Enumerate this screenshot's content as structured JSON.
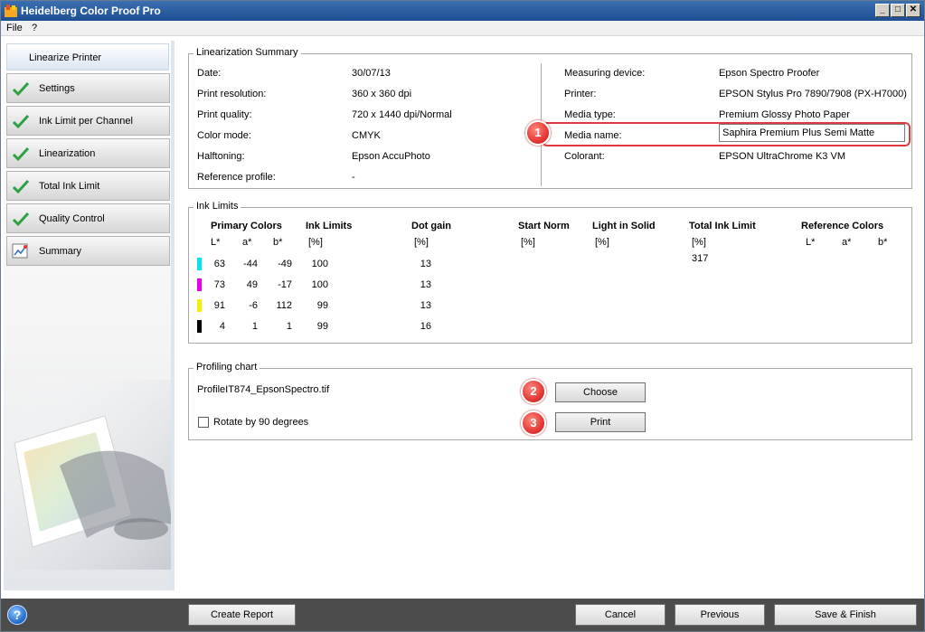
{
  "window": {
    "title": "Heidelberg Color Proof Pro",
    "controls": [
      "_",
      "□",
      "✕"
    ]
  },
  "menu": [
    "File",
    "?"
  ],
  "sidebar": {
    "header": "Linearize Printer",
    "items": [
      {
        "label": "Settings",
        "icon": "checkmark-icon"
      },
      {
        "label": "Ink Limit per Channel",
        "icon": "checkmark-icon"
      },
      {
        "label": "Linearization",
        "icon": "checkmark-icon"
      },
      {
        "label": "Total Ink Limit",
        "icon": "checkmark-icon"
      },
      {
        "label": "Quality Control",
        "icon": "checkmark-icon"
      },
      {
        "label": "Summary",
        "icon": "summary-chart-icon"
      }
    ]
  },
  "summary": {
    "title": "Linearization Summary",
    "left": [
      {
        "label": "Date:",
        "value": "30/07/13"
      },
      {
        "label": "Print resolution:",
        "value": "360 x 360 dpi"
      },
      {
        "label": "Print quality:",
        "value": "720 x 1440 dpi/Normal"
      },
      {
        "label": "Color mode:",
        "value": "CMYK"
      },
      {
        "label": "Halftoning:",
        "value": "Epson AccuPhoto"
      },
      {
        "label": "Reference profile:",
        "value": "-"
      }
    ],
    "right": [
      {
        "label": "Measuring device:",
        "value": "Epson Spectro Proofer"
      },
      {
        "label": "Printer:",
        "value": "EPSON Stylus Pro 7890/7908 (PX-H7000)"
      },
      {
        "label": "Media type:",
        "value": "Premium Glossy Photo Paper"
      },
      {
        "label": "Media name:",
        "value": "Saphira Premium Plus Semi Matte"
      },
      {
        "label": "Colorant:",
        "value": "EPSON UltraChrome K3 VM"
      }
    ]
  },
  "callouts": [
    "1",
    "2",
    "3"
  ],
  "ink_limits": {
    "title": "Ink Limits",
    "headers": {
      "primary_colors": "Primary Colors",
      "ink_limits": "Ink Limits",
      "dot_gain": "Dot gain",
      "start_norm": "Start Norm",
      "light_in_solid": "Light in Solid",
      "total_ink_limit": "Total Ink Limit",
      "reference_colors": "Reference Colors"
    },
    "subheaders": {
      "L": "L*",
      "a": "a*",
      "b": "b*",
      "pct": "[%]",
      "ref_L": "L*",
      "ref_a": "a*",
      "ref_b": "b*"
    },
    "rows": [
      {
        "color": "#00e5ee",
        "L": "63",
        "a": "-44",
        "b": "-49",
        "ink": "100",
        "dot": "13"
      },
      {
        "color": "#e600e6",
        "L": "73",
        "a": "49",
        "b": "-17",
        "ink": "100",
        "dot": "13"
      },
      {
        "color": "#f2f200",
        "L": "91",
        "a": "-6",
        "b": "112",
        "ink": "99",
        "dot": "13"
      },
      {
        "color": "#000000",
        "L": "4",
        "a": "1",
        "b": "1",
        "ink": "99",
        "dot": "16"
      }
    ],
    "total_ink_value": "317"
  },
  "profiling": {
    "title": "Profiling chart",
    "filename": "ProfileIT874_EpsonSpectro.tif",
    "rotate_label": "Rotate by 90 degrees",
    "choose_label": "Choose",
    "print_label": "Print"
  },
  "footer": {
    "help": "?",
    "create_report": "Create Report",
    "cancel": "Cancel",
    "previous": "Previous",
    "save_finish": "Save & Finish"
  },
  "colors": {
    "titlebar": "#1f4f92",
    "callout": "#e53935",
    "highlight": "#e0393e",
    "check": "#2ea043"
  }
}
